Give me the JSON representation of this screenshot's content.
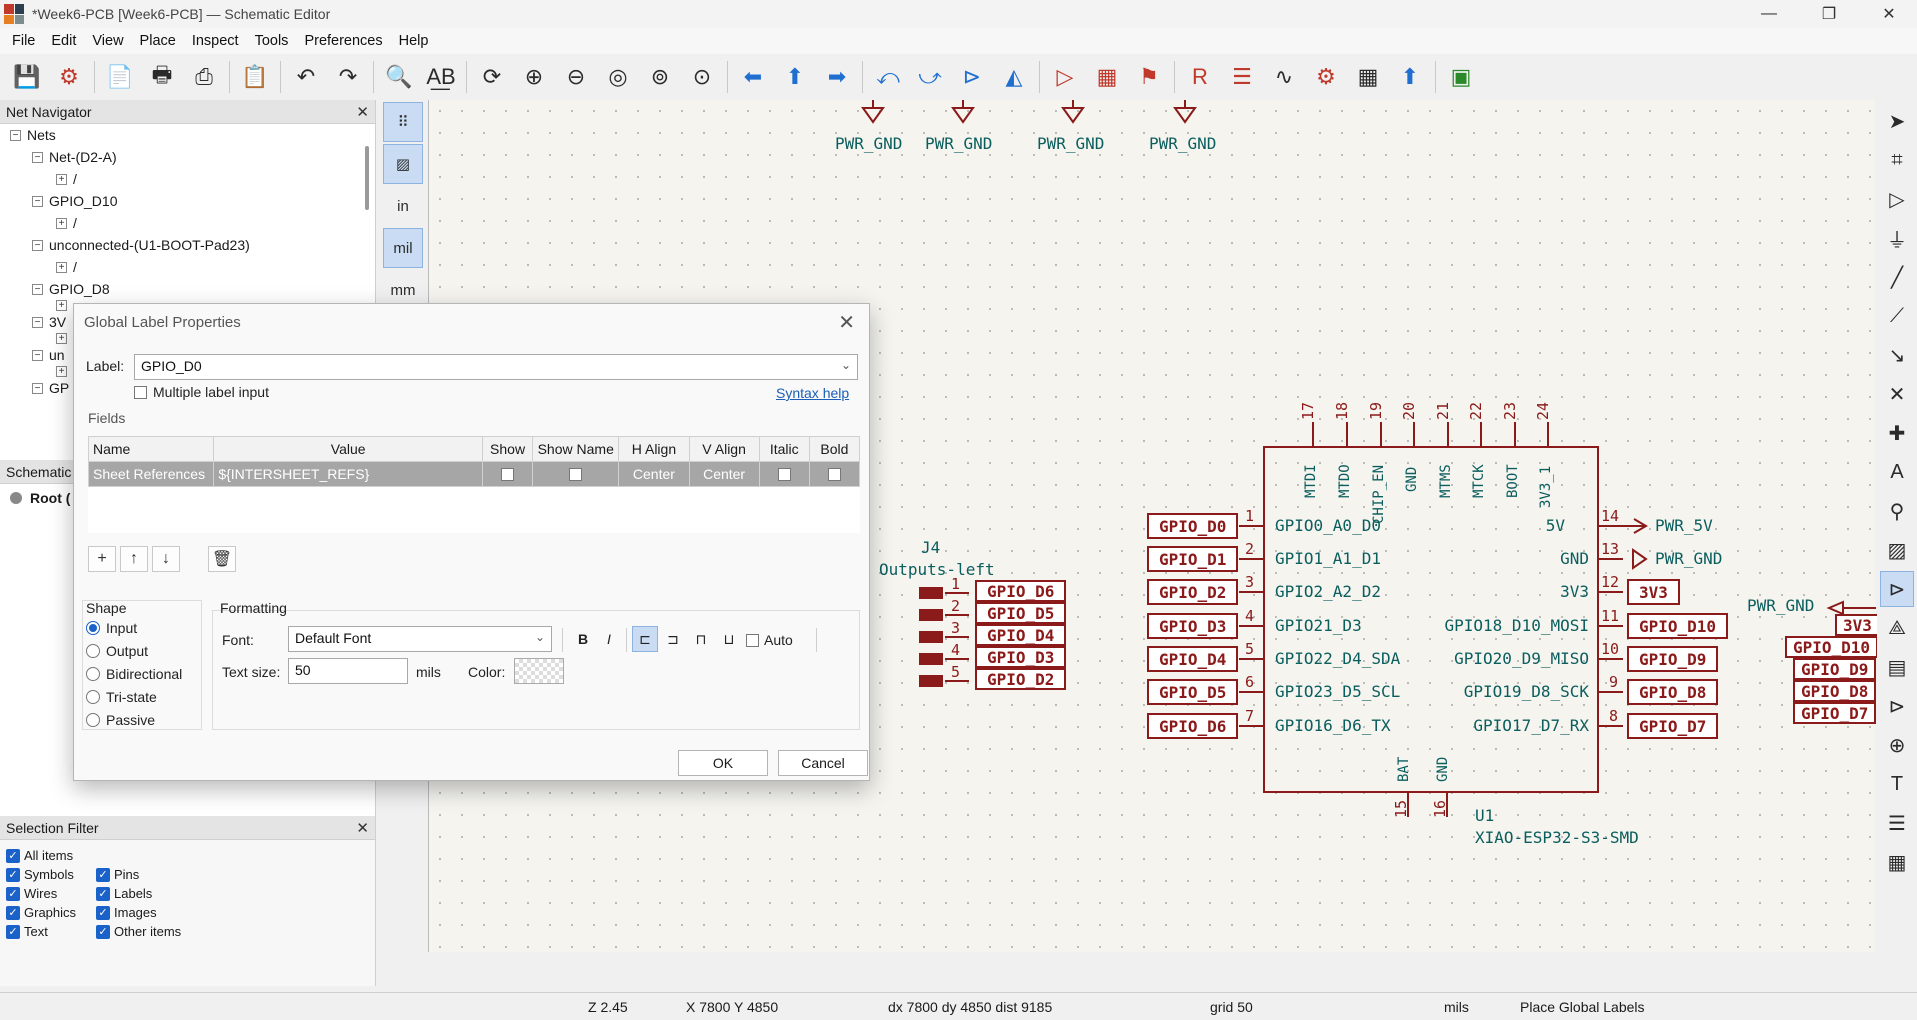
{
  "window": {
    "title": "*Week6-PCB [Week6-PCB] — Schematic Editor",
    "controls": [
      "—",
      "❐",
      "✕"
    ]
  },
  "menu": [
    "File",
    "Edit",
    "View",
    "Place",
    "Inspect",
    "Tools",
    "Preferences",
    "Help"
  ],
  "left_tools": {
    "units": [
      "in",
      "mil",
      "mm"
    ]
  },
  "net_navigator": {
    "title": "Net Navigator",
    "root": "Nets",
    "items": [
      {
        "label": "Net-(D2-A)",
        "child": "/"
      },
      {
        "label": "GPIO_D10",
        "child": "/"
      },
      {
        "label": "unconnected-(U1-BOOT-Pad23)",
        "child": "/"
      },
      {
        "label": "GPIO_D8",
        "child": ""
      },
      {
        "label": "3V",
        "child": ""
      },
      {
        "label": "un",
        "child": ""
      },
      {
        "label": "GP",
        "child": ""
      }
    ]
  },
  "schematic_panel": {
    "title": "Schematic",
    "root": "Root ("
  },
  "selection_filter": {
    "title": "Selection Filter",
    "items": [
      "All items",
      "Symbols",
      "Pins",
      "Wires",
      "Labels",
      "Graphics",
      "Images",
      "Text",
      "Other items"
    ]
  },
  "dialog": {
    "title": "Global Label Properties",
    "label_caption": "Label:",
    "label_value": "GPIO_D0",
    "multiple_label_input": "Multiple label input",
    "syntax_help": "Syntax help",
    "fields_caption": "Fields",
    "table_headers": [
      "Name",
      "Value",
      "Show",
      "Show Name",
      "H Align",
      "V Align",
      "Italic",
      "Bold"
    ],
    "row": {
      "name": "Sheet References",
      "value": "${INTERSHEET_REFS}",
      "h_align": "Center",
      "v_align": "Center"
    },
    "shape_caption": "Shape",
    "shapes": [
      "Input",
      "Output",
      "Bidirectional",
      "Tri-state",
      "Passive"
    ],
    "selected_shape": "Input",
    "formatting_caption": "Formatting",
    "font_caption": "Font:",
    "font_value": "Default Font",
    "text_size_caption": "Text size:",
    "text_size_value": "50",
    "text_size_unit": "mils",
    "color_caption": "Color:",
    "auto_label": "Auto",
    "ok": "OK",
    "cancel": "Cancel"
  },
  "schematic": {
    "power_top": [
      "PWR_GND",
      "PWR_GND",
      "PWR_GND",
      "PWR_GND"
    ],
    "connector_ref": "J4",
    "connector_value": "Outputs-left",
    "connector_labels": [
      "GPIO_D6",
      "GPIO_D5",
      "GPIO_D4",
      "GPIO_D3",
      "GPIO_D2"
    ],
    "connector_pins": [
      "1",
      "2",
      "3",
      "4",
      "5"
    ],
    "u1_ref": "U1",
    "u1_value": "XIAO-ESP32-S3-SMD",
    "top_pin_nums": [
      "17",
      "18",
      "19",
      "20",
      "21",
      "22",
      "23",
      "24"
    ],
    "top_pin_names": [
      "MTDI",
      "MTDO",
      "CHIP_EN",
      "GND",
      "MTMS",
      "MTCK",
      "BOOT",
      "3V3_1"
    ],
    "left_pins": [
      {
        "num": "1",
        "name": "GPIO0_A0_D0",
        "label": "GPIO_D0"
      },
      {
        "num": "2",
        "name": "GPIO1_A1_D1",
        "label": "GPIO_D1"
      },
      {
        "num": "3",
        "name": "GPIO2_A2_D2",
        "label": "GPIO_D2"
      },
      {
        "num": "4",
        "name": "GPIO21_D3",
        "label": "GPIO_D3"
      },
      {
        "num": "5",
        "name": "GPIO22_D4_SDA",
        "label": "GPIO_D4"
      },
      {
        "num": "6",
        "name": "GPIO23_D5_SCL",
        "label": "GPIO_D5"
      },
      {
        "num": "7",
        "name": "GPIO16_D6_TX",
        "label": "GPIO_D6"
      }
    ],
    "right_pins": [
      {
        "num": "14",
        "name": "5V",
        "label": "PWR_5V"
      },
      {
        "num": "13",
        "name": "GND",
        "label": "PWR_GND"
      },
      {
        "num": "12",
        "name": "3V3",
        "label": "3V3"
      },
      {
        "num": "11",
        "name": "GPIO18_D10_MOSI",
        "label": "GPIO_D10"
      },
      {
        "num": "10",
        "name": "GPIO20_D9_MISO",
        "label": "GPIO_D9"
      },
      {
        "num": "9",
        "name": "GPIO19_D8_SCK",
        "label": "GPIO_D8"
      },
      {
        "num": "8",
        "name": "GPIO17_D7_RX",
        "label": "GPIO_D7"
      }
    ],
    "bottom_pin_nums": [
      "15",
      "16"
    ],
    "bottom_pin_names": [
      "BAT",
      "GND"
    ],
    "far_right_power": "PWR_GND",
    "far_right_labels": [
      "3V3",
      "GPIO_D10",
      "GPIO_D9",
      "GPIO_D8",
      "GPIO_D7"
    ]
  },
  "status": {
    "zoom": "Z 2.45",
    "xy": "X 7800  Y 4850",
    "delta": "dx 7800  dy 4850  dist 9185",
    "grid": "grid 50",
    "units": "mils",
    "mode": "Place Global Labels"
  },
  "colors": {
    "label_border": "#8b1a1a",
    "schematic_text": "#0b5e5e",
    "accent": "#1a62c9",
    "canvas_bg": "#f5f4ef"
  }
}
